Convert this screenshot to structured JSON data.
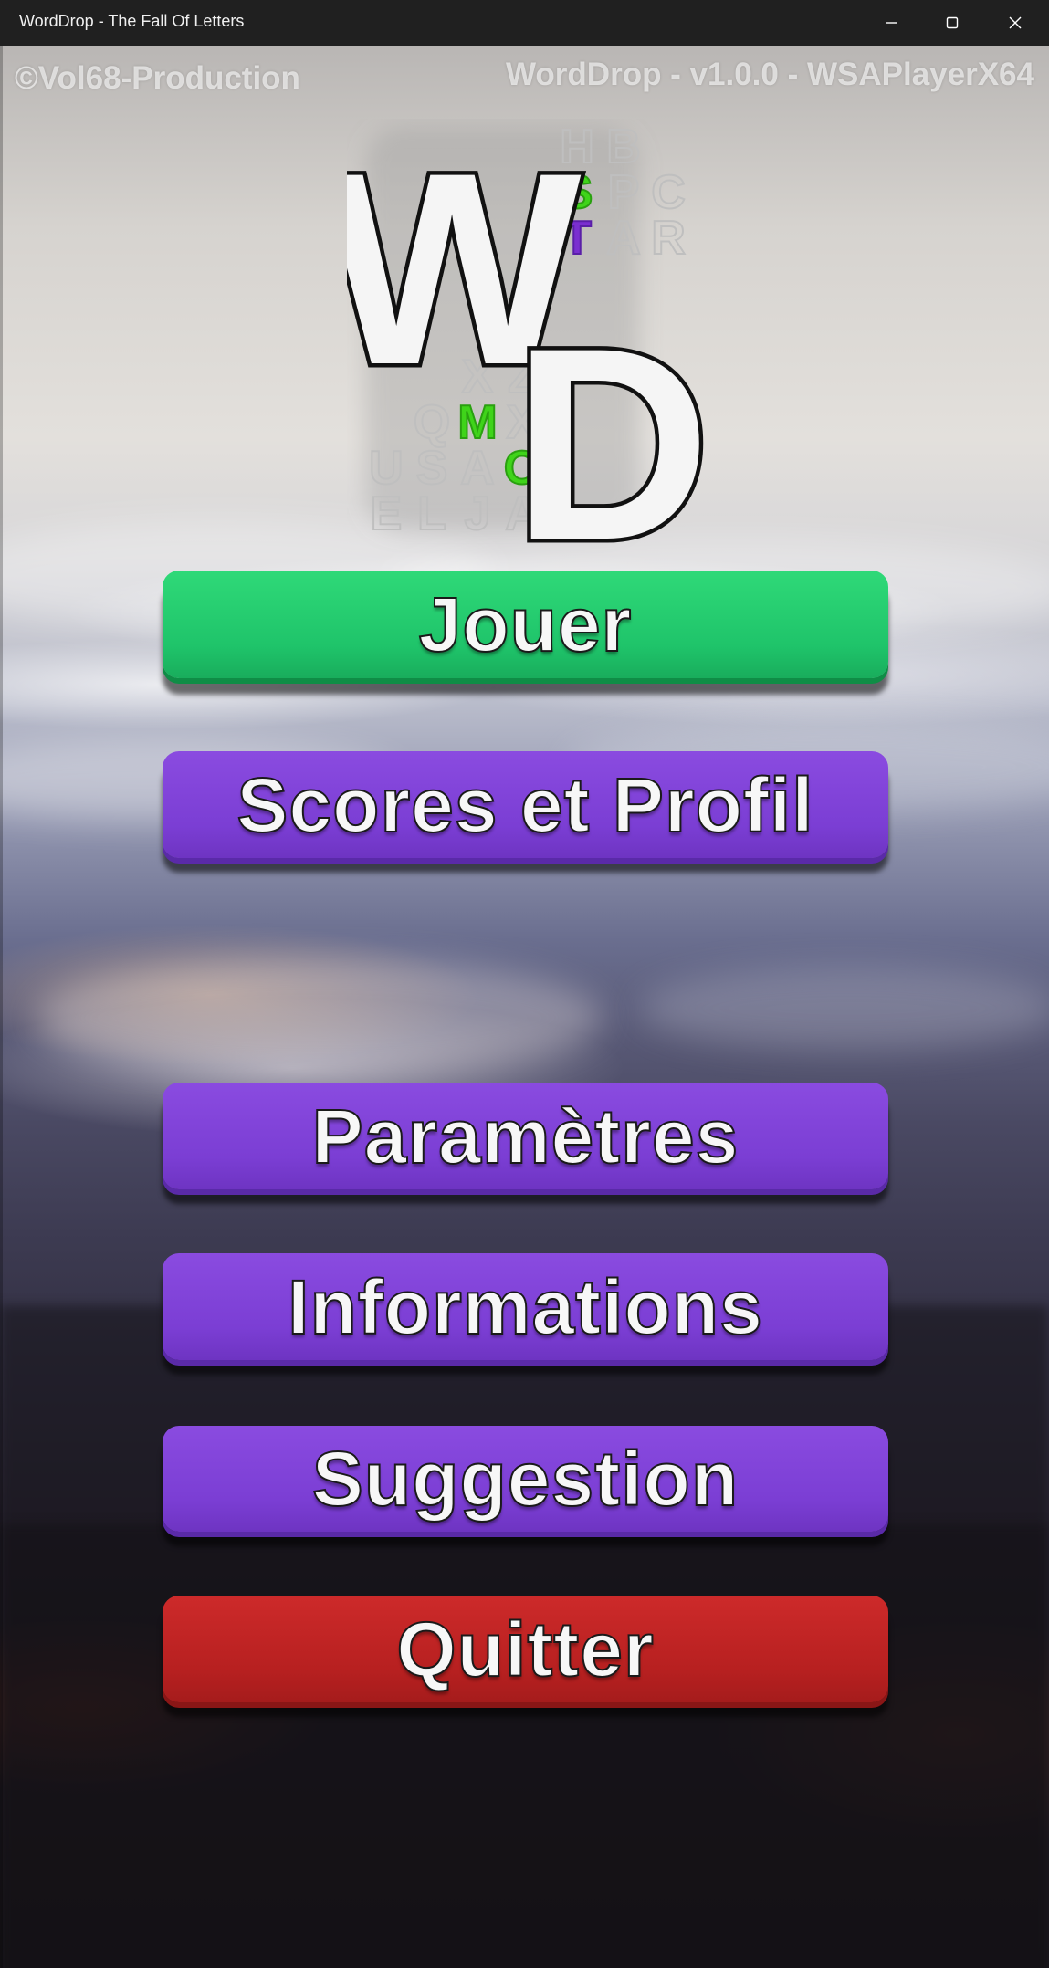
{
  "window": {
    "title": "WordDrop - The Fall Of Letters",
    "controls": {
      "minimize": "minimize-icon",
      "maximize": "maximize-icon",
      "close": "close-icon"
    }
  },
  "overlay": {
    "copyright": "©Vol68-Production",
    "version": "WordDrop - v1.0.0 - WSAPlayerX64"
  },
  "logo": {
    "big_letters": [
      "W",
      "D"
    ],
    "falling_letters": [
      "H",
      "B",
      "S",
      "P",
      "C",
      "T",
      "A",
      "R",
      "X",
      "Z",
      "Q",
      "M",
      "X",
      "U",
      "S",
      "A",
      "O",
      "E",
      "L",
      "J",
      "A"
    ],
    "colors": {
      "green": "#3fd41a",
      "purple": "#7a2fd0",
      "grey": "#cfcfcf"
    }
  },
  "menu": {
    "play": "Jouer",
    "scores": "Scores et Profil",
    "settings": "Paramètres",
    "info": "Informations",
    "suggestion": "Suggestion",
    "quit": "Quitter"
  },
  "colors": {
    "play_button": "#22cf70",
    "menu_button": "#7f42d8",
    "quit_button": "#bd2323",
    "title_bar": "#202020"
  }
}
